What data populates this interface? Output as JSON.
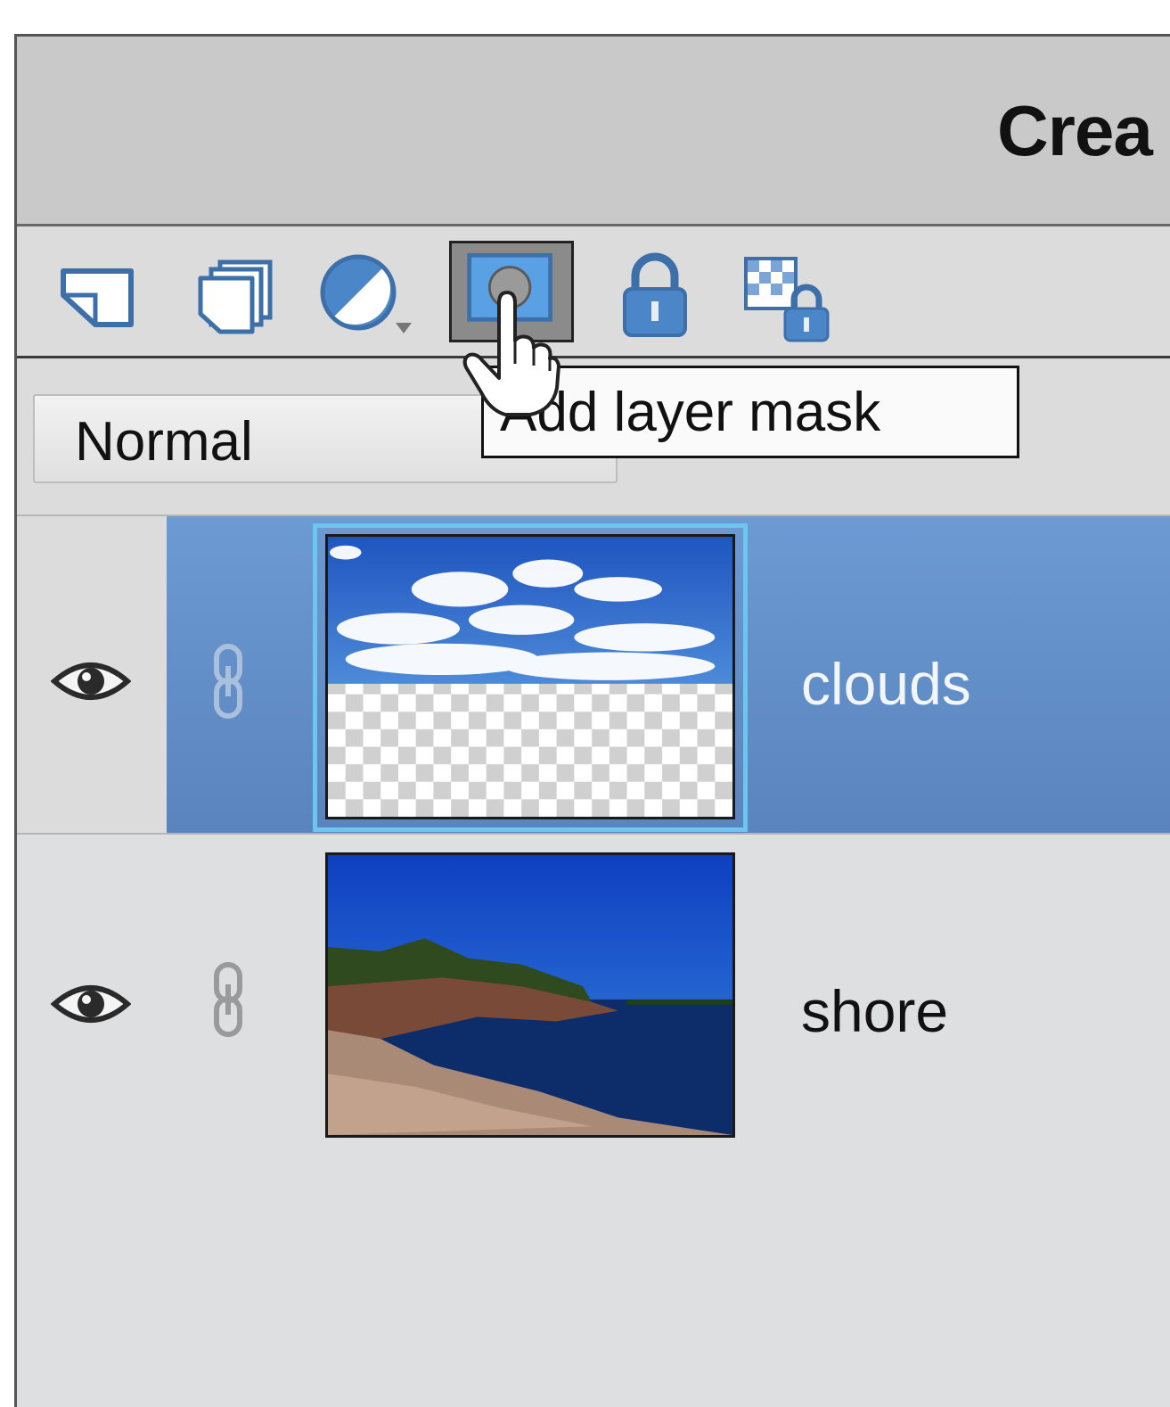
{
  "panel": {
    "title": "Crea"
  },
  "toolbar": {
    "tools": [
      {
        "icon": "new-layer-icon"
      },
      {
        "icon": "new-group-icon"
      },
      {
        "icon": "adjustment-layer-icon"
      },
      {
        "icon": "add-layer-mask-icon",
        "active": true
      },
      {
        "icon": "lock-all-icon"
      },
      {
        "icon": "lock-transparency-icon"
      }
    ]
  },
  "blend_mode": {
    "value": "Normal"
  },
  "tooltip": {
    "text": "Add layer mask"
  },
  "layers": [
    {
      "name": "clouds",
      "selected": true,
      "visible": true
    },
    {
      "name": "shore",
      "selected": false,
      "visible": true
    }
  ],
  "colors": {
    "selection": "#5f8ac4",
    "selection_outline": "#6ec6ee",
    "panel_bg": "#dedfe1",
    "icon_blue": "#4a86c8"
  }
}
